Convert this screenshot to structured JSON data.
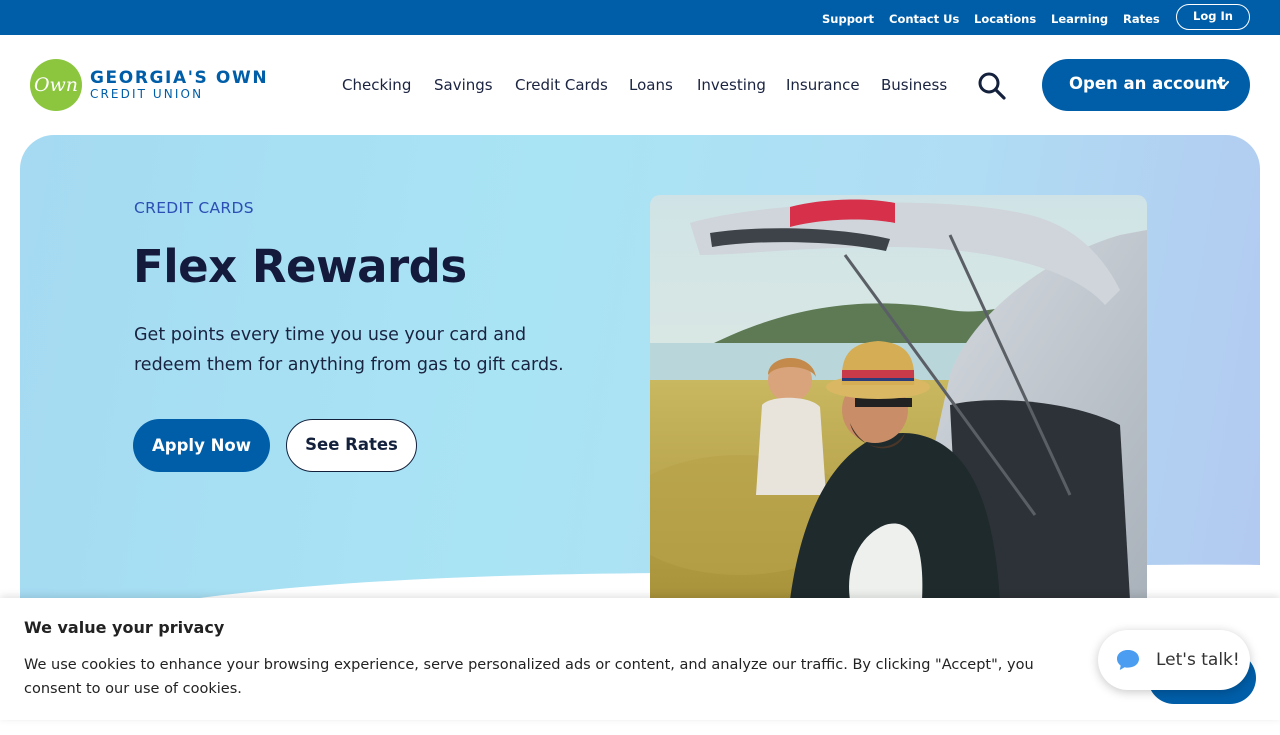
{
  "utility_nav": {
    "links": [
      "Support",
      "Contact Us",
      "Locations",
      "Learning",
      "Rates"
    ],
    "login_label": "Log In"
  },
  "brand": {
    "logo_mark": "Own",
    "name_line1": "GEORGIA'S OWN",
    "name_line2": "CREDIT UNION",
    "colors": {
      "primary": "#005ea8",
      "logo_green": "#8cc63f",
      "title": "#141a3c"
    }
  },
  "main_nav": {
    "items": [
      "Checking",
      "Savings",
      "Credit Cards",
      "Loans",
      "Investing",
      "Insurance",
      "Business"
    ],
    "search_icon": "search-icon",
    "cta_label": "Open an account",
    "cta_icon": "chevron-down-icon"
  },
  "hero": {
    "eyebrow": "CREDIT CARDS",
    "title": "Flex Rewards",
    "description": "Get points every time you use your card and redeem them for anything from gas to gift cards.",
    "primary_button": "Apply Now",
    "secondary_button": "See Rates"
  },
  "cookie_banner": {
    "title": "We value your privacy",
    "text": "We use cookies to enhance your browsing experience, serve personalized ads or content, and analyze our traffic. By clicking \"Accept\", you consent to our use of cookies."
  },
  "chat": {
    "label": "Let's talk!",
    "icon": "chat-bubble-icon"
  }
}
